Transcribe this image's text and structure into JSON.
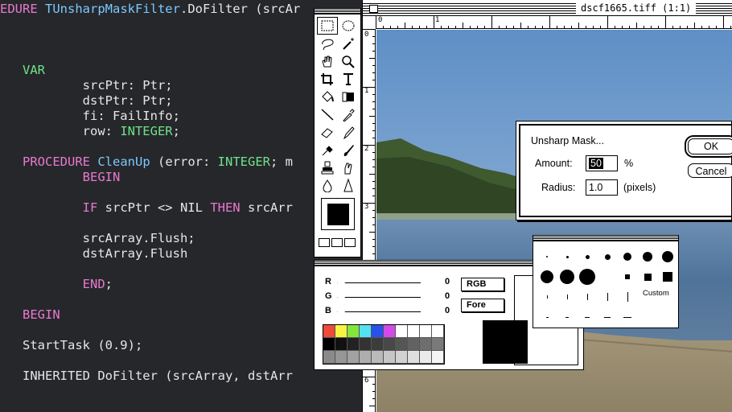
{
  "editor": {
    "lines": [
      {
        "segments": [
          {
            "text": "EDURE ",
            "cls": "kw-pink"
          },
          {
            "text": "TUnsharpMaskFilter",
            "cls": "kw-blue"
          },
          {
            "text": ".DoFilter (srcAr",
            "cls": ""
          }
        ]
      },
      {
        "segments": []
      },
      {
        "segments": []
      },
      {
        "segments": []
      },
      {
        "segments": [
          {
            "text": "   ",
            "cls": ""
          },
          {
            "text": "VAR",
            "cls": "kw-green"
          }
        ]
      },
      {
        "segments": [
          {
            "text": "           srcPtr: Ptr;",
            "cls": ""
          }
        ]
      },
      {
        "segments": [
          {
            "text": "           dstPtr: Ptr;",
            "cls": ""
          }
        ]
      },
      {
        "segments": [
          {
            "text": "           fi: FailInfo;",
            "cls": ""
          }
        ]
      },
      {
        "segments": [
          {
            "text": "           row: ",
            "cls": ""
          },
          {
            "text": "INTEGER",
            "cls": "kw-green"
          },
          {
            "text": ";",
            "cls": ""
          }
        ]
      },
      {
        "segments": []
      },
      {
        "segments": [
          {
            "text": "   ",
            "cls": ""
          },
          {
            "text": "PROCEDURE ",
            "cls": "kw-pink"
          },
          {
            "text": "CleanUp",
            "cls": "kw-blue"
          },
          {
            "text": " (error: ",
            "cls": ""
          },
          {
            "text": "INTEGER",
            "cls": "kw-green"
          },
          {
            "text": "; m",
            "cls": ""
          }
        ]
      },
      {
        "segments": [
          {
            "text": "           ",
            "cls": ""
          },
          {
            "text": "BEGIN",
            "cls": "kw-pink"
          }
        ]
      },
      {
        "segments": []
      },
      {
        "segments": [
          {
            "text": "           ",
            "cls": ""
          },
          {
            "text": "IF ",
            "cls": "kw-pink"
          },
          {
            "text": "srcPtr <> NIL ",
            "cls": ""
          },
          {
            "text": "THEN ",
            "cls": "kw-pink"
          },
          {
            "text": "srcArr",
            "cls": ""
          }
        ]
      },
      {
        "segments": []
      },
      {
        "segments": [
          {
            "text": "           srcArray.Flush;",
            "cls": ""
          }
        ]
      },
      {
        "segments": [
          {
            "text": "           dstArray.Flush",
            "cls": ""
          }
        ]
      },
      {
        "segments": []
      },
      {
        "segments": [
          {
            "text": "           ",
            "cls": ""
          },
          {
            "text": "END",
            "cls": "kw-pink"
          },
          {
            "text": ";",
            "cls": ""
          }
        ]
      },
      {
        "segments": []
      },
      {
        "segments": [
          {
            "text": "   ",
            "cls": ""
          },
          {
            "text": "BEGIN",
            "cls": "kw-pink"
          }
        ]
      },
      {
        "segments": []
      },
      {
        "segments": [
          {
            "text": "   StartTask (0.9);",
            "cls": ""
          }
        ]
      },
      {
        "segments": []
      },
      {
        "segments": [
          {
            "text": "   INHERITED DoFilter (srcArray, dstArr",
            "cls": ""
          }
        ]
      }
    ]
  },
  "document": {
    "title": "dscf1665.tiff (1:1)",
    "ruler_top_numbers": [
      "0",
      "1"
    ],
    "ruler_left_numbers": [
      "0",
      "1",
      "2",
      "3",
      "6"
    ]
  },
  "dialog": {
    "title": "Unsharp Mask...",
    "amount_label": "Amount:",
    "amount_value": "50",
    "amount_unit": "%",
    "radius_label": "Radius:",
    "radius_value": "1.0",
    "radius_unit": "(pixels)",
    "ok_label": "OK",
    "cancel_label": "Cancel"
  },
  "picker": {
    "r_label": "R",
    "g_label": "G",
    "b_label": "B",
    "r_value": "0",
    "g_value": "0",
    "b_value": "0",
    "mode_button": "RGB",
    "target_button": "Fore",
    "swatch_rows": [
      [
        "#f04a3a",
        "#f8f442",
        "#84e63a",
        "#54e2f0",
        "#2a50ec",
        "#d44ae8",
        "#ffffff",
        "#ffffff",
        "#ffffff",
        "#ffffff"
      ],
      [
        "#000000",
        "#111111",
        "#222222",
        "#333333",
        "#3c3c3c",
        "#484848",
        "#555555",
        "#626262",
        "#6e6e6e",
        "#7a7a7a"
      ],
      [
        "#8a8a8a",
        "#969696",
        "#a2a2a2",
        "#aeaeae",
        "#bababa",
        "#c6c6c6",
        "#d2d2d2",
        "#dedede",
        "#eaeaea",
        "#f6f6f6"
      ]
    ]
  },
  "brushes": {
    "custom_label": "Custom"
  },
  "colors": {
    "editor_bg": "#26272b",
    "keyword_pink": "#e879ce",
    "keyword_green": "#6fe389",
    "identifier_blue": "#7cc8ff"
  }
}
